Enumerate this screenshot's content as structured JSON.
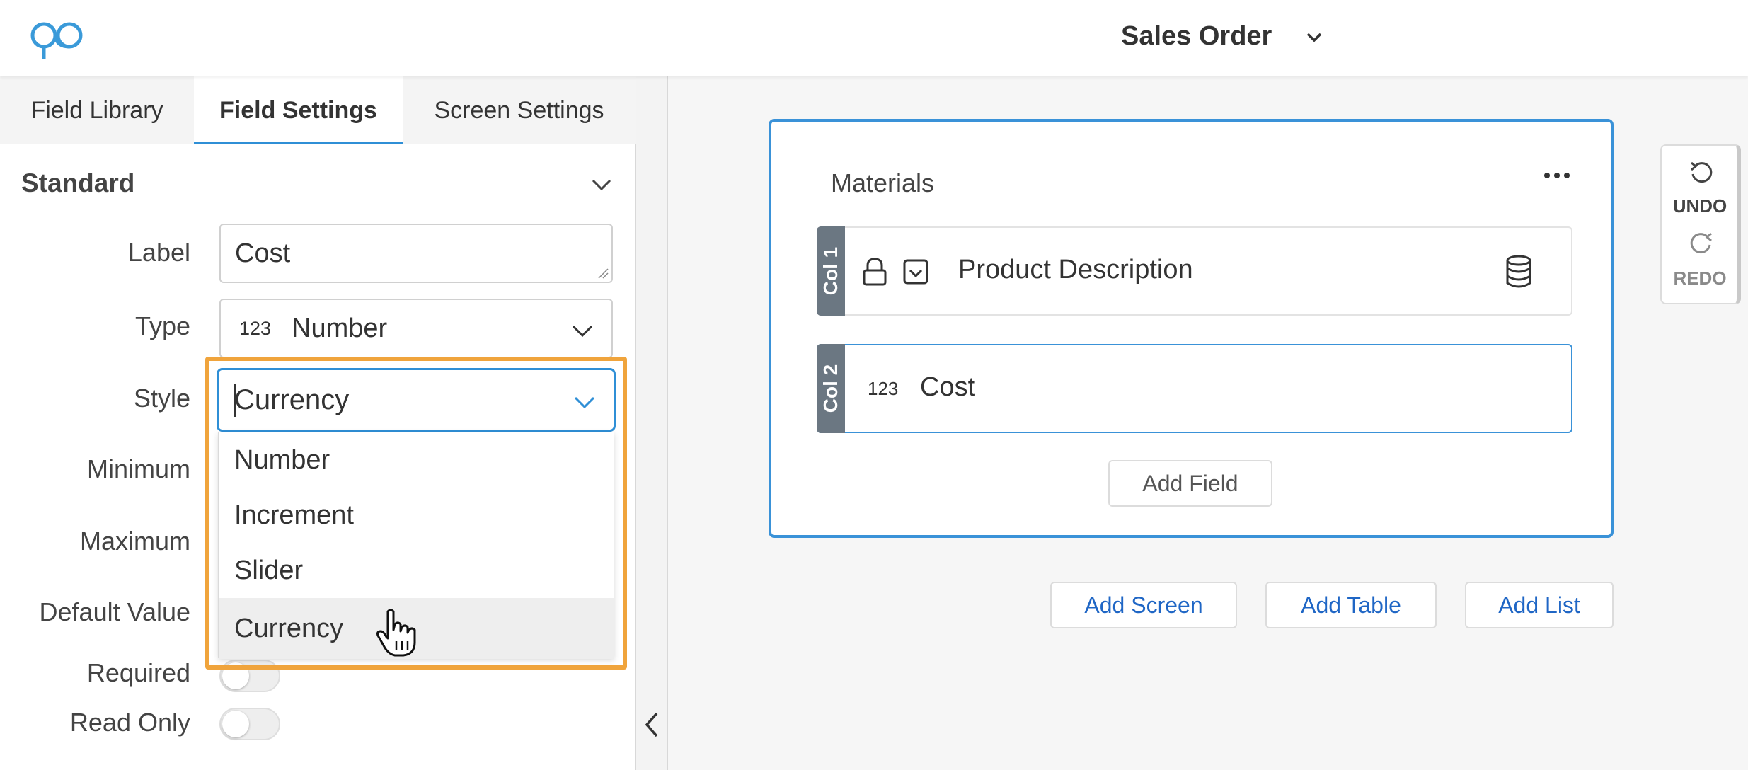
{
  "header": {
    "title": "Sales Order"
  },
  "tabs": [
    {
      "label": "Field Library"
    },
    {
      "label": "Field Settings"
    },
    {
      "label": "Screen Settings"
    }
  ],
  "settings": {
    "section_title": "Standard",
    "labels": {
      "label": "Label",
      "type": "Type",
      "style": "Style",
      "minimum": "Minimum",
      "maximum": "Maximum",
      "default_value": "Default Value",
      "required": "Required",
      "read_only": "Read Only"
    },
    "label_value": "Cost",
    "type_icon": "123",
    "type_value": "Number",
    "style_value": "Currency",
    "style_options": [
      "Number",
      "Increment",
      "Slider",
      "Currency"
    ],
    "required": false,
    "read_only": false
  },
  "canvas": {
    "card_title": "Materials",
    "rows": [
      {
        "tag": "Col 1",
        "label": "Product Description"
      },
      {
        "tag": "Col 2",
        "icon_text": "123",
        "label": "Cost"
      }
    ],
    "add_field": "Add Field",
    "buttons": {
      "add_screen": "Add Screen",
      "add_table": "Add Table",
      "add_list": "Add List"
    }
  },
  "history": {
    "undo": "UNDO",
    "redo": "REDO"
  },
  "colors": {
    "accent": "#2f8fd6",
    "highlight": "#f0a43c",
    "link": "#1f66c5"
  }
}
